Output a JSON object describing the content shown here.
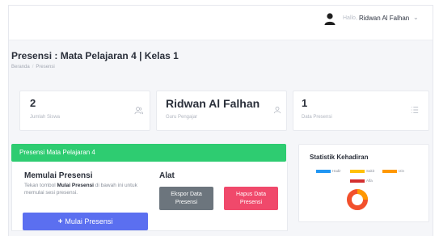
{
  "topbar": {
    "greeting": "Hallo,",
    "user_name": "Ridwan Al Falhan",
    "avatar_icon": "user-avatar-icon",
    "chevron_icon": "chevron-down-icon"
  },
  "page": {
    "title": "Presensi : Mata Pelajaran 4 | Kelas 1",
    "breadcrumb": [
      "Beranda",
      "Presensi"
    ]
  },
  "stats": [
    {
      "value": "2",
      "label": "Jumlah Siswa",
      "icon": "users-icon"
    },
    {
      "value": "Ridwan Al Falhan",
      "label": "Guru Pengajar",
      "icon": "user-icon"
    },
    {
      "value": "1",
      "label": "Data Presensi",
      "icon": "list-icon"
    }
  ],
  "panel": {
    "header": "Presensi Mata Pelajaran 4",
    "start_title": "Memulai Presensi",
    "start_desc_prefix": "Tekan tombol ",
    "start_desc_bold": "Mulai Presensi",
    "start_desc_suffix": " di bawah ini untuk memulai sesi presensi.",
    "start_button": "Mulai Presensi",
    "tools_title": "Alat",
    "export_button": "Ekspor Data Presensi",
    "delete_button": "Hapus Data Presensi"
  },
  "statistics": {
    "title": "Statistik Kehadiran",
    "legend": [
      {
        "label": "Hadir",
        "color": "#2196f3"
      },
      {
        "label": "Sakit",
        "color": "#ffc107"
      },
      {
        "label": "Izin",
        "color": "#ff9800"
      },
      {
        "label": "Alfa",
        "color": "#d32f2f"
      }
    ]
  },
  "colors": {
    "accent_green": "#2ecc71",
    "primary_blue": "#5b6ff0",
    "secondary_gray": "#6c757d",
    "danger_pink": "#f0496b"
  }
}
